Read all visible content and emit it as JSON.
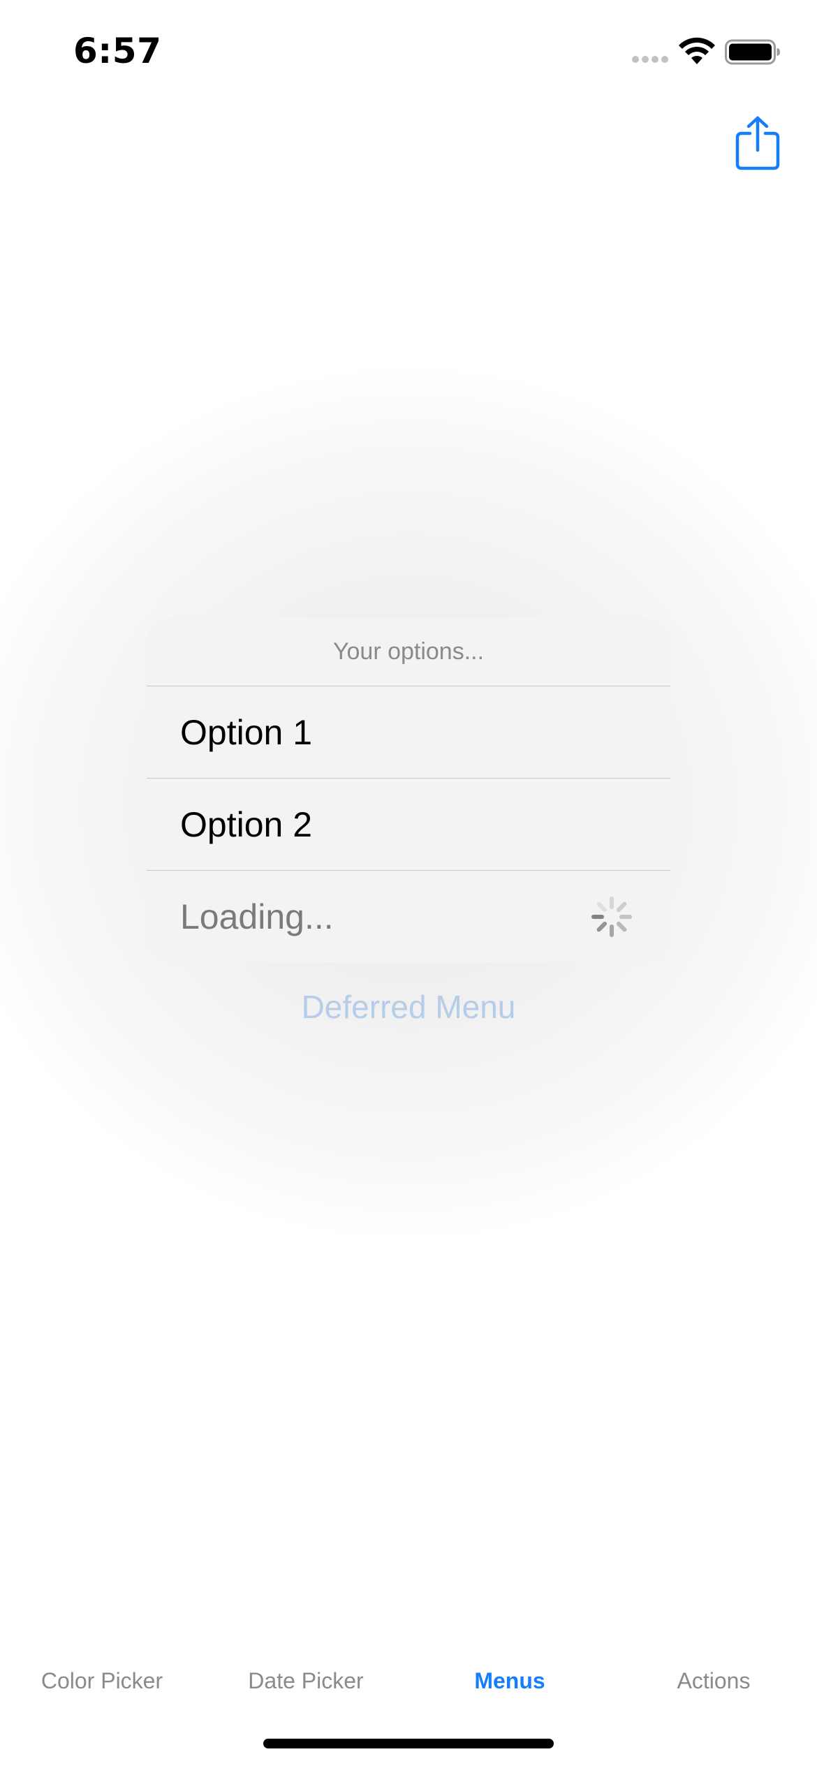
{
  "status_bar": {
    "time": "6:57"
  },
  "nav": {
    "share_icon": "share-icon"
  },
  "menu": {
    "header": "Your options...",
    "items": [
      {
        "label": "Option 1"
      },
      {
        "label": "Option 2"
      },
      {
        "label": "Loading...",
        "state": "loading"
      }
    ]
  },
  "deferred_menu_label": "Deferred Menu",
  "tab_bar": {
    "tabs": [
      {
        "label": "Color Picker",
        "active": false
      },
      {
        "label": "Date Picker",
        "active": false
      },
      {
        "label": "Menus",
        "active": true
      },
      {
        "label": "Actions",
        "active": false
      }
    ]
  },
  "colors": {
    "accent": "#157EFB",
    "tab_inactive": "#8A8A8E",
    "menu_background": "#F3F3F2"
  }
}
